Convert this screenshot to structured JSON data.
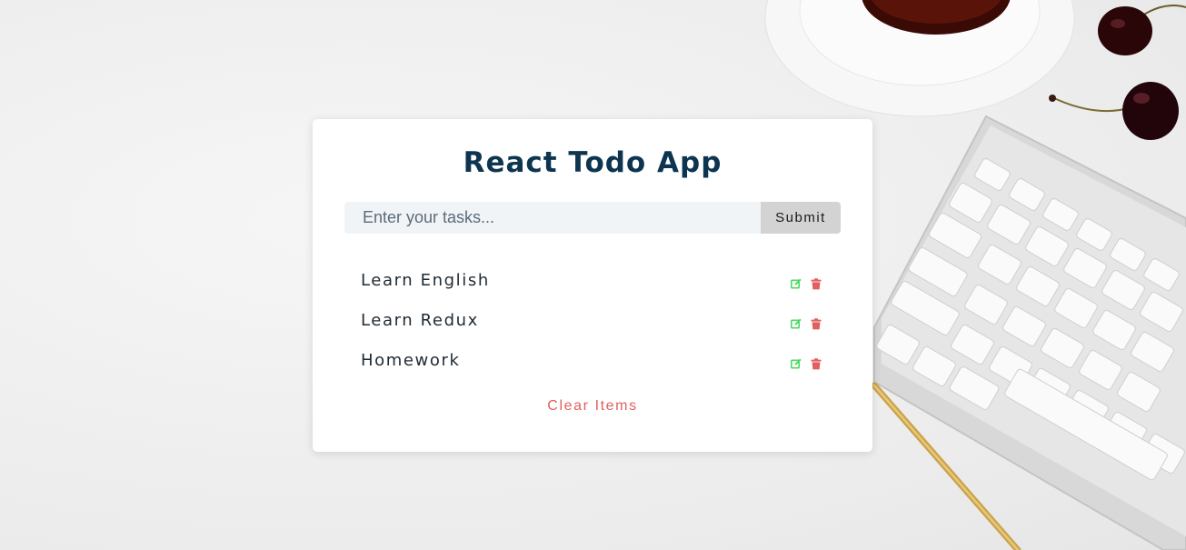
{
  "app": {
    "title": "React Todo App"
  },
  "form": {
    "input_placeholder": "Enter your tasks...",
    "input_value": "",
    "submit_label": "Submit"
  },
  "todos": [
    {
      "text": "Learn English",
      "edit_icon": "edit-icon",
      "delete_icon": "trash-icon"
    },
    {
      "text": "Learn Redux",
      "edit_icon": "edit-icon",
      "delete_icon": "trash-icon"
    },
    {
      "text": "Homework",
      "edit_icon": "edit-icon",
      "delete_icon": "trash-icon"
    }
  ],
  "clear_label": "Clear Items",
  "colors": {
    "title": "#0d3550",
    "edit": "#4cd964",
    "delete": "#e0605c",
    "clear": "#e0605c",
    "submit_bg": "#d3d3d3",
    "input_bg": "#f1f4f6"
  }
}
